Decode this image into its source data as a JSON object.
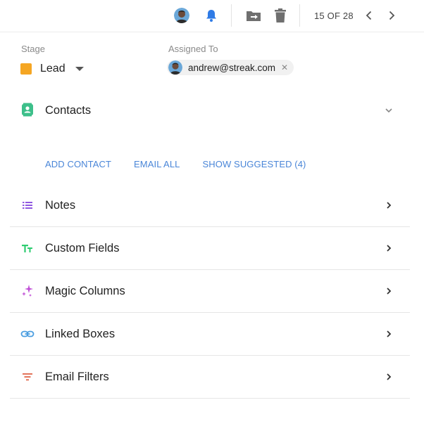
{
  "toolbar": {
    "record_position": "15 OF 28",
    "icons": [
      "avatar",
      "bell-icon",
      "move-to-folder-icon",
      "trash-icon",
      "chevron-left-icon",
      "chevron-right-icon"
    ],
    "bell_color": "#2f7be6"
  },
  "stage": {
    "label": "Stage",
    "value": "Lead",
    "color": "#f5a623"
  },
  "assigned": {
    "label": "Assigned To",
    "email": "andrew@streak.com",
    "remove_glyph": "✕"
  },
  "contacts": {
    "label": "Contacts",
    "icon_color": "#3dbf8a",
    "actions": {
      "add": "ADD CONTACT",
      "email_all": "EMAIL ALL",
      "show_suggested": "SHOW SUGGESTED (4)"
    }
  },
  "sections": [
    {
      "label": "Notes",
      "icon": "list-icon",
      "color": "#8f57e0"
    },
    {
      "label": "Custom Fields",
      "icon": "text-format-icon",
      "color": "#2ecc71"
    },
    {
      "label": "Magic Columns",
      "icon": "sparkle-icon",
      "color": "#c04fd6"
    },
    {
      "label": "Linked Boxes",
      "icon": "link-icon",
      "color": "#4a9de0"
    },
    {
      "label": "Email Filters",
      "icon": "filter-icon",
      "color": "#e0664a"
    }
  ]
}
